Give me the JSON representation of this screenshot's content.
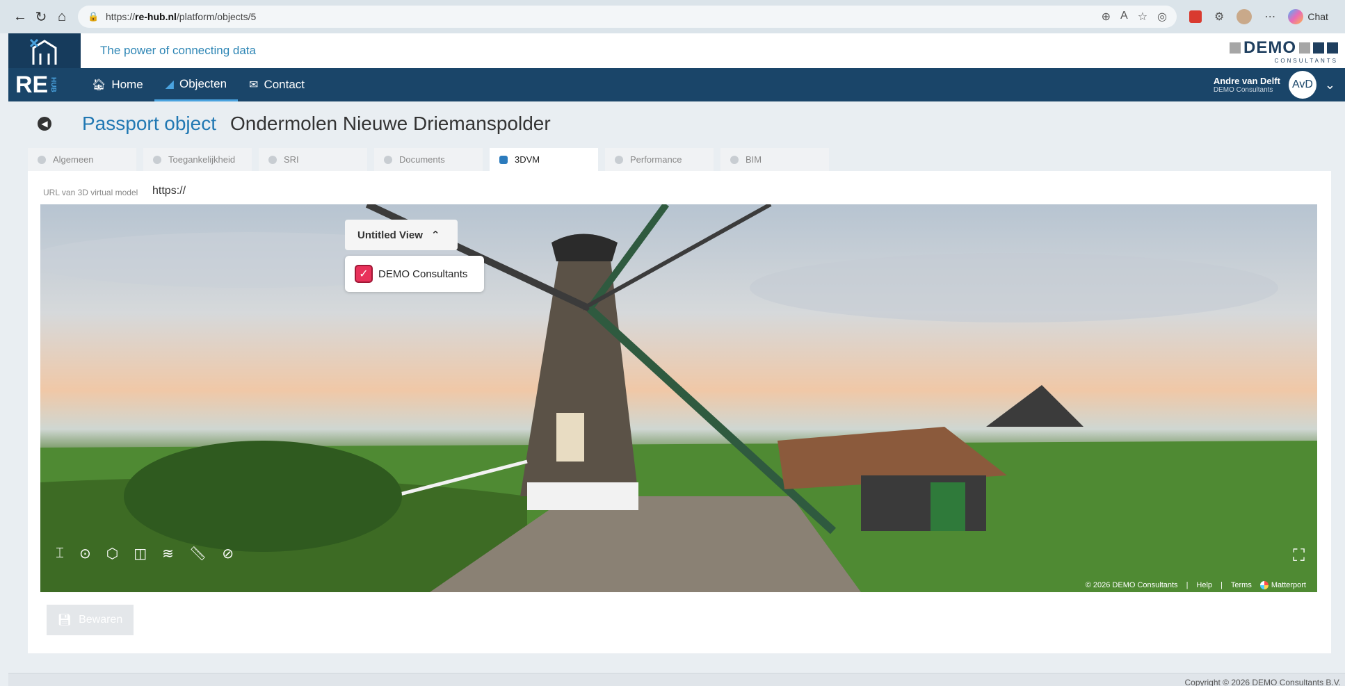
{
  "browser": {
    "url_prefix": "https://",
    "url_host": "re-hub.nl",
    "url_path": "/platform/objects/5",
    "chat_label": "Chat"
  },
  "header": {
    "tagline": "The power of connecting data",
    "brand_word": "DEMO",
    "brand_sub": "CONSULTANTS",
    "re_logo": "RE",
    "re_logo_vertical": "HUB"
  },
  "nav": {
    "items": [
      {
        "label": "Home",
        "icon": "home-icon"
      },
      {
        "label": "Objecten",
        "icon": "chart-icon"
      },
      {
        "label": "Contact",
        "icon": "envelope-icon"
      }
    ],
    "user_name": "Andre van Delft",
    "user_org": "DEMO Consultants",
    "user_initials": "AvD"
  },
  "page": {
    "title": "Passport object",
    "object_name": "Ondermolen Nieuwe Driemanspolder"
  },
  "tabs": [
    {
      "label": "Algemeen"
    },
    {
      "label": "Toegankelijkheid"
    },
    {
      "label": "SRI"
    },
    {
      "label": "Documents"
    },
    {
      "label": "3DVM",
      "active": true
    },
    {
      "label": "Performance"
    },
    {
      "label": "BIM"
    }
  ],
  "form": {
    "url_label": "URL van 3D virtual model",
    "url_value": "https://"
  },
  "viewer": {
    "view_name": "Untitled View",
    "layer_label": "DEMO Consultants",
    "layer_checked": true,
    "footer_copyright": "© 2026 DEMO Consultants",
    "footer_help": "Help",
    "footer_terms": "Terms",
    "footer_brand": "Matterport",
    "accent_color": "#e8315a"
  },
  "actions": {
    "save_label": "Bewaren"
  },
  "footer": {
    "copyright": "Copyright © 2026 DEMO Consultants B.V."
  }
}
